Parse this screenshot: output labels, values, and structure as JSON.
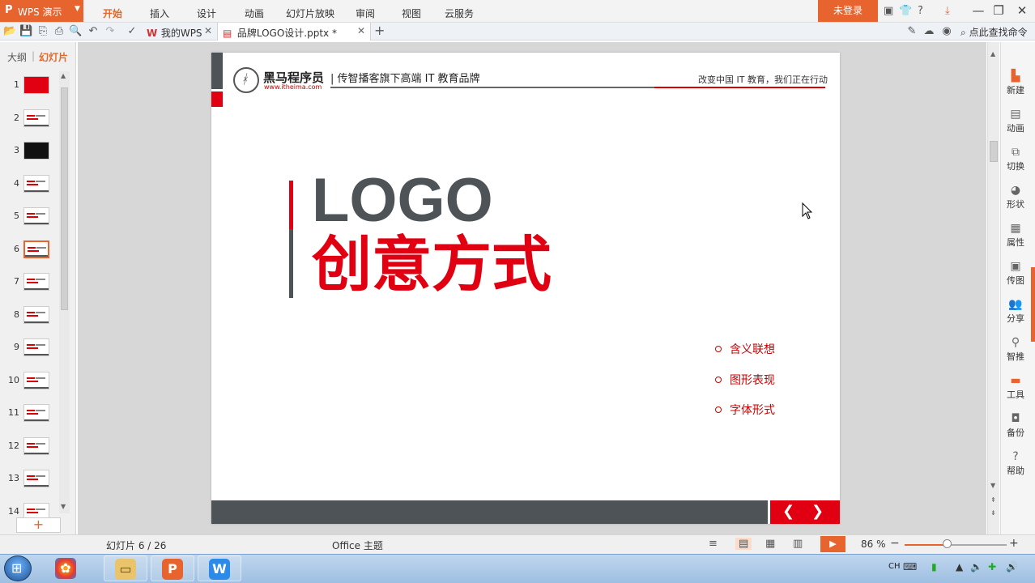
{
  "menubar": {
    "app_name": "WPS 演示",
    "app_logo": "P",
    "items": [
      "开始",
      "插入",
      "设计",
      "动画",
      "幻灯片放映",
      "审阅",
      "视图",
      "云服务"
    ],
    "active_item": "开始",
    "login_label": "未登录"
  },
  "toolbar": {
    "tabs": [
      {
        "label": "我的WPS",
        "icon": "wps-w-icon"
      },
      {
        "label": "品牌LOGO设计.pptx *",
        "icon": "pptx-file-icon"
      }
    ],
    "command_search": "点此查找命令"
  },
  "left_panel": {
    "tab_outline": "大纲",
    "tab_slides": "幻灯片",
    "thumbnails": [
      "1",
      "2",
      "3",
      "4",
      "5",
      "6",
      "7",
      "8",
      "9",
      "10",
      "11",
      "12",
      "13",
      "14"
    ],
    "selected": "6",
    "add_label": "+"
  },
  "slide": {
    "brand_name": "黑马程序员",
    "brand_url": "www.itheima.com",
    "slogan": "| 传智播客旗下高端 IT 教育品牌",
    "tagline": "改变中国 IT 教育，我们正在行动",
    "title_line1": "LOGO",
    "title_line2": "创意方式",
    "bullets": [
      "含义联想",
      "图形表现",
      "字体形式"
    ],
    "nav_prev": "❮",
    "nav_next": "❯",
    "colors": {
      "accent_red": "#e00012",
      "dark_gray": "#4d5357"
    }
  },
  "right_sidebar": {
    "items": [
      {
        "label": "新建",
        "icon": "new-file-icon"
      },
      {
        "label": "动画",
        "icon": "animation-icon"
      },
      {
        "label": "切换",
        "icon": "transition-icon"
      },
      {
        "label": "形状",
        "icon": "shape-icon"
      },
      {
        "label": "属性",
        "icon": "properties-icon"
      },
      {
        "label": "传图",
        "icon": "upload-image-icon"
      },
      {
        "label": "分享",
        "icon": "share-icon"
      },
      {
        "label": "智推",
        "icon": "recommend-icon"
      },
      {
        "label": "工具",
        "icon": "toolbox-icon"
      },
      {
        "label": "备份",
        "icon": "backup-icon"
      },
      {
        "label": "帮助",
        "icon": "help-icon"
      }
    ]
  },
  "statusbar": {
    "slide_counter": "幻灯片 6 / 26",
    "theme": "Office 主题",
    "zoom": "86 %",
    "zoom_minus": "−",
    "zoom_plus": "+"
  },
  "taskbar": {
    "lang": "CH",
    "apps": [
      "windows-explorer-icon",
      "wps-presentation-icon",
      "wps-writer-icon"
    ]
  },
  "accent_color": "#e8642f"
}
